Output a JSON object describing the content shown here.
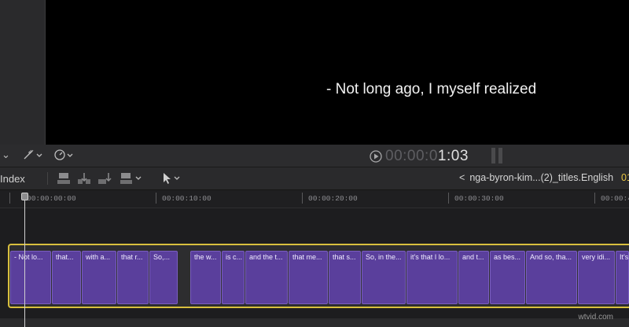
{
  "viewer": {
    "subtitle": "- Not long ago, I myself realized"
  },
  "playback": {
    "timecode_dim": "00:00:0",
    "timecode_bright": "1:03"
  },
  "viewer_controls": {
    "view_menu_chevron": "⌄",
    "transform_icon": "magic-wand-icon",
    "speed_icon": "speedometer-icon"
  },
  "timeline_toolbar": {
    "index_label": "Index",
    "breadcrumb": "nga-byron-kim...(2)_titles.English",
    "breadcrumb_chevron": "<",
    "trailing_fragment": "01"
  },
  "ruler": {
    "labels": [
      "00:00:00:00",
      "00:00:10:00",
      "00:00:20:00",
      "00:00:30:00",
      "00:00:4"
    ]
  },
  "clips": [
    "- Not lo...",
    "that...",
    "with a...",
    "that r...",
    "So,...",
    "the w...",
    "is c...",
    "and the t...",
    "that me...",
    "that s...",
    "So, in the...",
    "it's that I lo...",
    "and t...",
    "as bes...",
    "And so, tha...",
    "very idi...",
    "It's"
  ],
  "colors": {
    "clip_fill": "#5a3f9c",
    "selection_border": "#d8bf3e",
    "accent_yellow": "#e8c541"
  },
  "watermark": "wtvid.com"
}
